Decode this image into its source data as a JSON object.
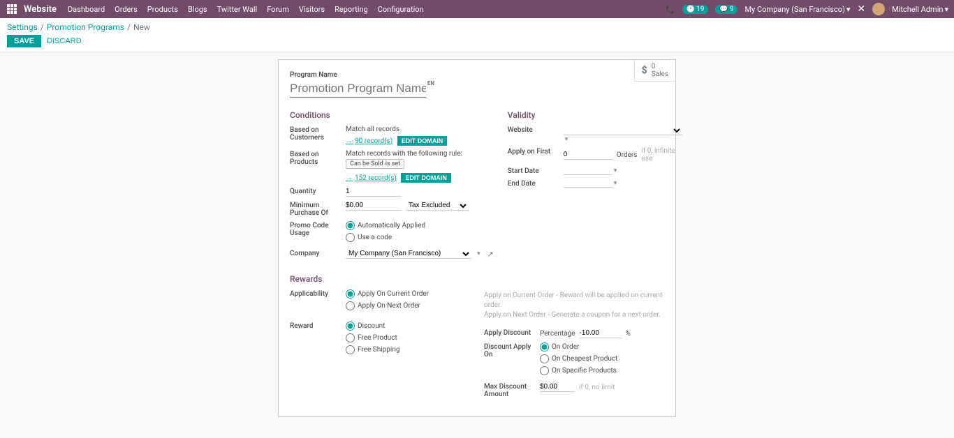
{
  "topbar": {
    "brand": "Website",
    "menu": [
      "Dashboard",
      "Orders",
      "Products",
      "Blogs",
      "Twitter Wall",
      "Forum",
      "Visitors",
      "Reporting",
      "Configuration"
    ],
    "badge1": "19",
    "badge2": "9",
    "company": "My Company (San Francisco)",
    "user": "Mitchell Admin"
  },
  "breadcrumb": {
    "a": "Settings",
    "b": "Promotion Programs",
    "c": "New"
  },
  "buttons": {
    "save": "Save",
    "discard": "Discard",
    "edit_domain": "Edit Domain"
  },
  "sales_box": {
    "count": "0",
    "label": "Sales"
  },
  "form": {
    "program_name_label": "Program Name",
    "program_name_placeholder": "Promotion Program Name",
    "lang": "EN",
    "sections": {
      "conditions": "Conditions",
      "validity": "Validity",
      "rewards": "Rewards"
    },
    "labels": {
      "based_customers": "Based on Customers",
      "based_products": "Based on Products",
      "quantity": "Quantity",
      "min_purchase": "Minimum Purchase Of",
      "promo_code": "Promo Code Usage",
      "company": "Company",
      "website": "Website",
      "apply_first": "Apply on First",
      "start_date": "Start Date",
      "end_date": "End Date",
      "applicability": "Applicability",
      "reward": "Reward",
      "apply_discount": "Apply Discount",
      "discount_apply_on": "Discount Apply On",
      "max_discount": "Max Discount Amount"
    },
    "values": {
      "match_all": "Match all records",
      "customers_records": "90 record(s)",
      "products_match": "Match records with the following rule:",
      "rule_pill_a": "Can be Sold",
      "rule_pill_b": "is set",
      "products_records": "152 record(s)",
      "quantity": "1",
      "min_purchase_amount": "$0.00",
      "tax_option": "Tax Excluded",
      "promo_auto": "Automatically Applied",
      "promo_code": "Use a code",
      "company": "My Company (San Francisco)",
      "apply_first_value": "0",
      "apply_first_suffix": "Orders",
      "apply_first_hint": "if 0, infinite use",
      "applicability_current": "Apply On Current Order",
      "applicability_next": "Apply On Next Order",
      "applicability_hint1": "Apply on Current Order - Reward will be applied on current order.",
      "applicability_hint2": "Apply on Next Order - Generate a coupon for a next order.",
      "reward_discount": "Discount",
      "reward_free_product": "Free Product",
      "reward_free_shipping": "Free Shipping",
      "apply_discount_type": "Percentage",
      "apply_discount_value": "-10.00",
      "apply_discount_suffix": "%",
      "discount_on_order": "On Order",
      "discount_cheapest": "On Cheapest Product",
      "discount_specific": "On Specific Products",
      "max_discount_value": "$0.00",
      "max_discount_hint": "if 0, no limit"
    }
  }
}
